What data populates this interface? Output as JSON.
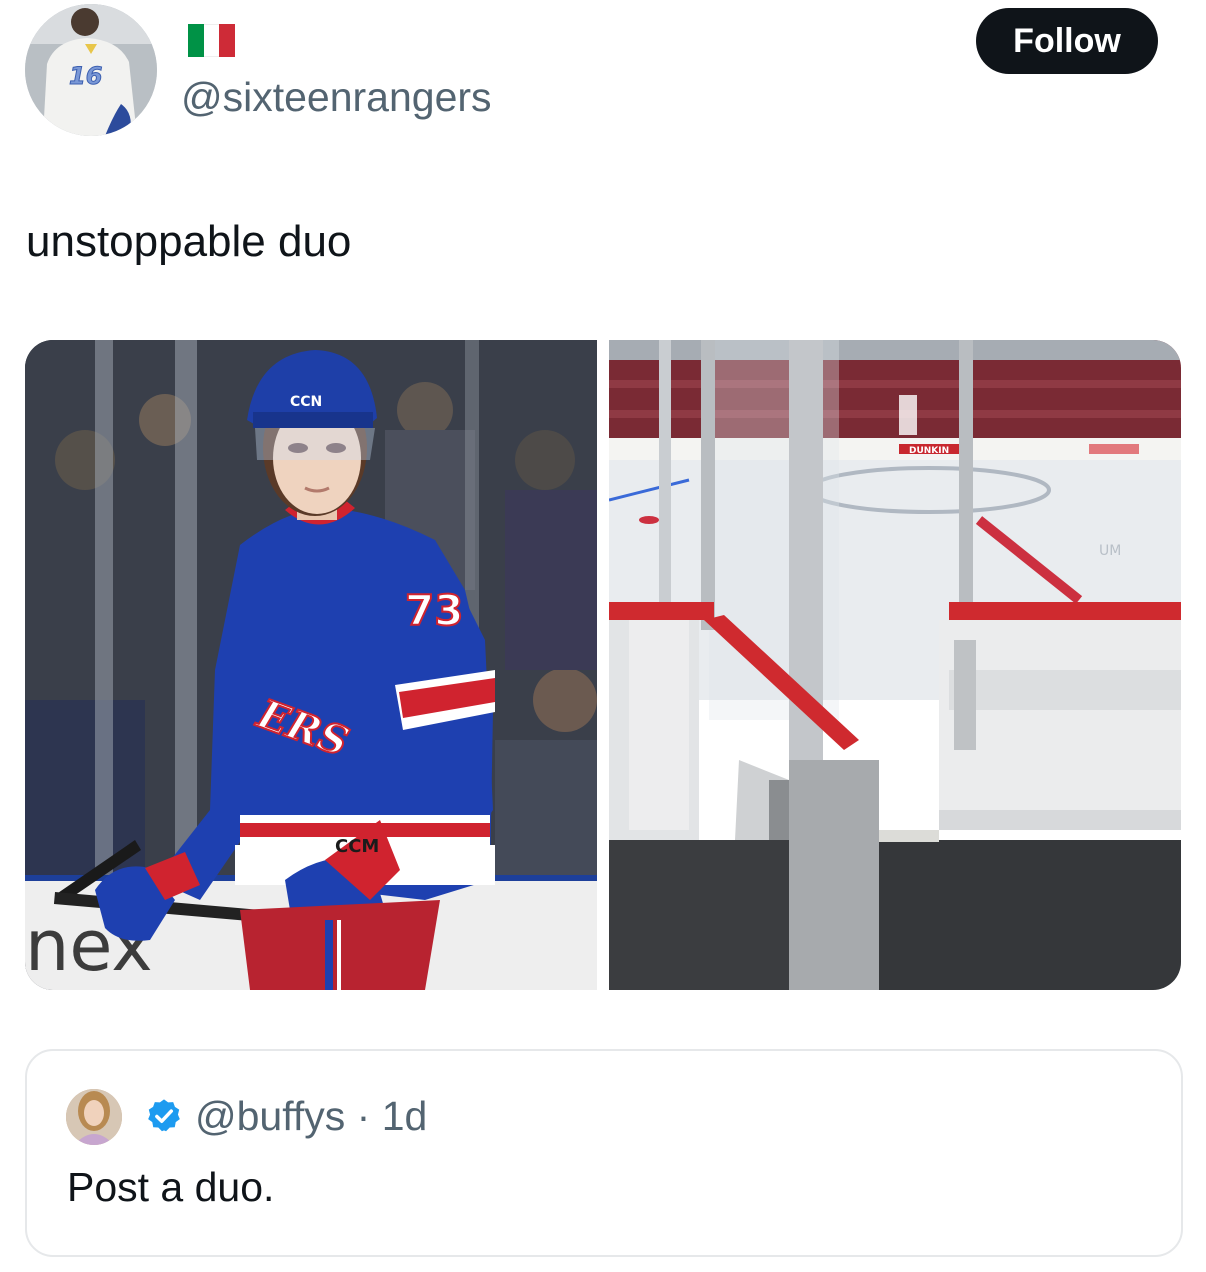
{
  "author": {
    "handle": "@sixteenrangers",
    "flag_colors": [
      "#009246",
      "#ffffff",
      "#ce2b37"
    ],
    "avatar_jersey_number": "16"
  },
  "follow_button": {
    "label": "Follow"
  },
  "tweet": {
    "text": "unstoppable duo"
  },
  "media": {
    "left_photo": {
      "jersey_number": "73",
      "helmet_brand": "CCN",
      "board_text": "nex",
      "glove_brand": "CCM"
    },
    "right_photo": {
      "dasher_ad": "DUNKIN"
    }
  },
  "quoted_tweet": {
    "handle": "@buffys",
    "separator": " · ",
    "time": "1d",
    "text": "Post a duo."
  },
  "colors": {
    "rangers_blue": "#1e40b0",
    "rangers_red": "#d0232f",
    "verified_blue": "#1d9bf0"
  }
}
